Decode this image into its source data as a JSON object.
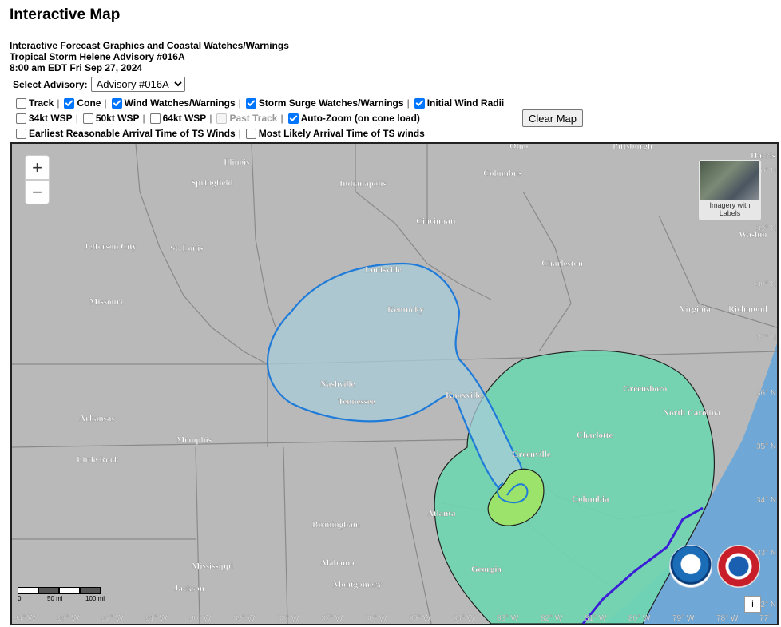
{
  "header": {
    "title": "Interactive Map",
    "subtitle": "Interactive Forecast Graphics and Coastal Watches/Warnings",
    "storm_line": "Tropical Storm Helene Advisory #016A",
    "time_line": "8:00 am EDT Fri Sep 27, 2024"
  },
  "advisory": {
    "label": "Select Advisory:",
    "selected": "Advisory #016A"
  },
  "options": {
    "row1": [
      {
        "label": "Track",
        "checked": false
      },
      {
        "label": "Cone",
        "checked": true
      },
      {
        "label": "Wind Watches/Warnings",
        "checked": true
      },
      {
        "label": "Storm Surge Watches/Warnings",
        "checked": true
      },
      {
        "label": "Initial Wind Radii",
        "checked": true
      }
    ],
    "row2": [
      {
        "label": "34kt WSP",
        "checked": false
      },
      {
        "label": "50kt WSP",
        "checked": false
      },
      {
        "label": "64kt WSP",
        "checked": false
      },
      {
        "label": "Past Track",
        "checked": false,
        "disabled": true
      },
      {
        "label": "Auto-Zoom (on cone load)",
        "checked": true
      }
    ],
    "row3": [
      {
        "label": "Earliest Reasonable Arrival Time of TS Winds",
        "checked": false
      },
      {
        "label": "Most Likely Arrival Time of TS winds",
        "checked": false
      }
    ],
    "separator": "|"
  },
  "buttons": {
    "clear_map": "Clear Map",
    "zoom_in": "+",
    "zoom_out": "−",
    "info": "i"
  },
  "basemap": {
    "imagery_label_1": "Imagery with",
    "imagery_label_2": "Labels"
  },
  "scale": {
    "labels": [
      "0",
      "50 mi",
      "100 mi"
    ]
  },
  "map_labels": {
    "states": [
      "Illinois",
      "Indianapolis",
      "Ohio",
      "Missouri",
      "Kentucky",
      "Virginia",
      "Tennessee",
      "Arkansas",
      "North Carolina",
      "Georgia",
      "Alabama",
      "Mississippi"
    ],
    "cities": [
      "Springfield",
      "Columbus",
      "Pittsburgh",
      "Cincinnati",
      "Jefferson City",
      "St. Louis",
      "Louisville",
      "Charleston",
      "Richmond",
      "Washin",
      "Harris",
      "Nashville",
      "Knoxville",
      "Greensboro",
      "Charlotte",
      "Memphis",
      "Little Rock",
      "Greenville",
      "Atlanta",
      "Columbia",
      "Birmingham",
      "Montgomery",
      "Jackson"
    ]
  },
  "axis": {
    "longitudes": [
      "94° W",
      "93° W",
      "92° W",
      "91° W",
      "90° W",
      "89° W",
      "88° W",
      "87° W",
      "86° W",
      "85° W",
      "84° W",
      "83° W",
      "82° W",
      "81° W",
      "80° W",
      "79° W",
      "78° W",
      "77°"
    ],
    "latitudes": [
      "40° N",
      "39° N",
      "38° N",
      "37° N",
      "36° N",
      "35° N",
      "34° N",
      "33° N",
      "32° N"
    ]
  },
  "colors": {
    "cone_outline": "#1e7bd9",
    "cone_fill": "#a8ccd8",
    "tropical_storm_wind": "#6fd6b0",
    "hurricane_wind": "#9be36a",
    "ocean": "#6fa8d6",
    "warning_line": "#3a1fd6",
    "land": "#b9b9b9"
  }
}
